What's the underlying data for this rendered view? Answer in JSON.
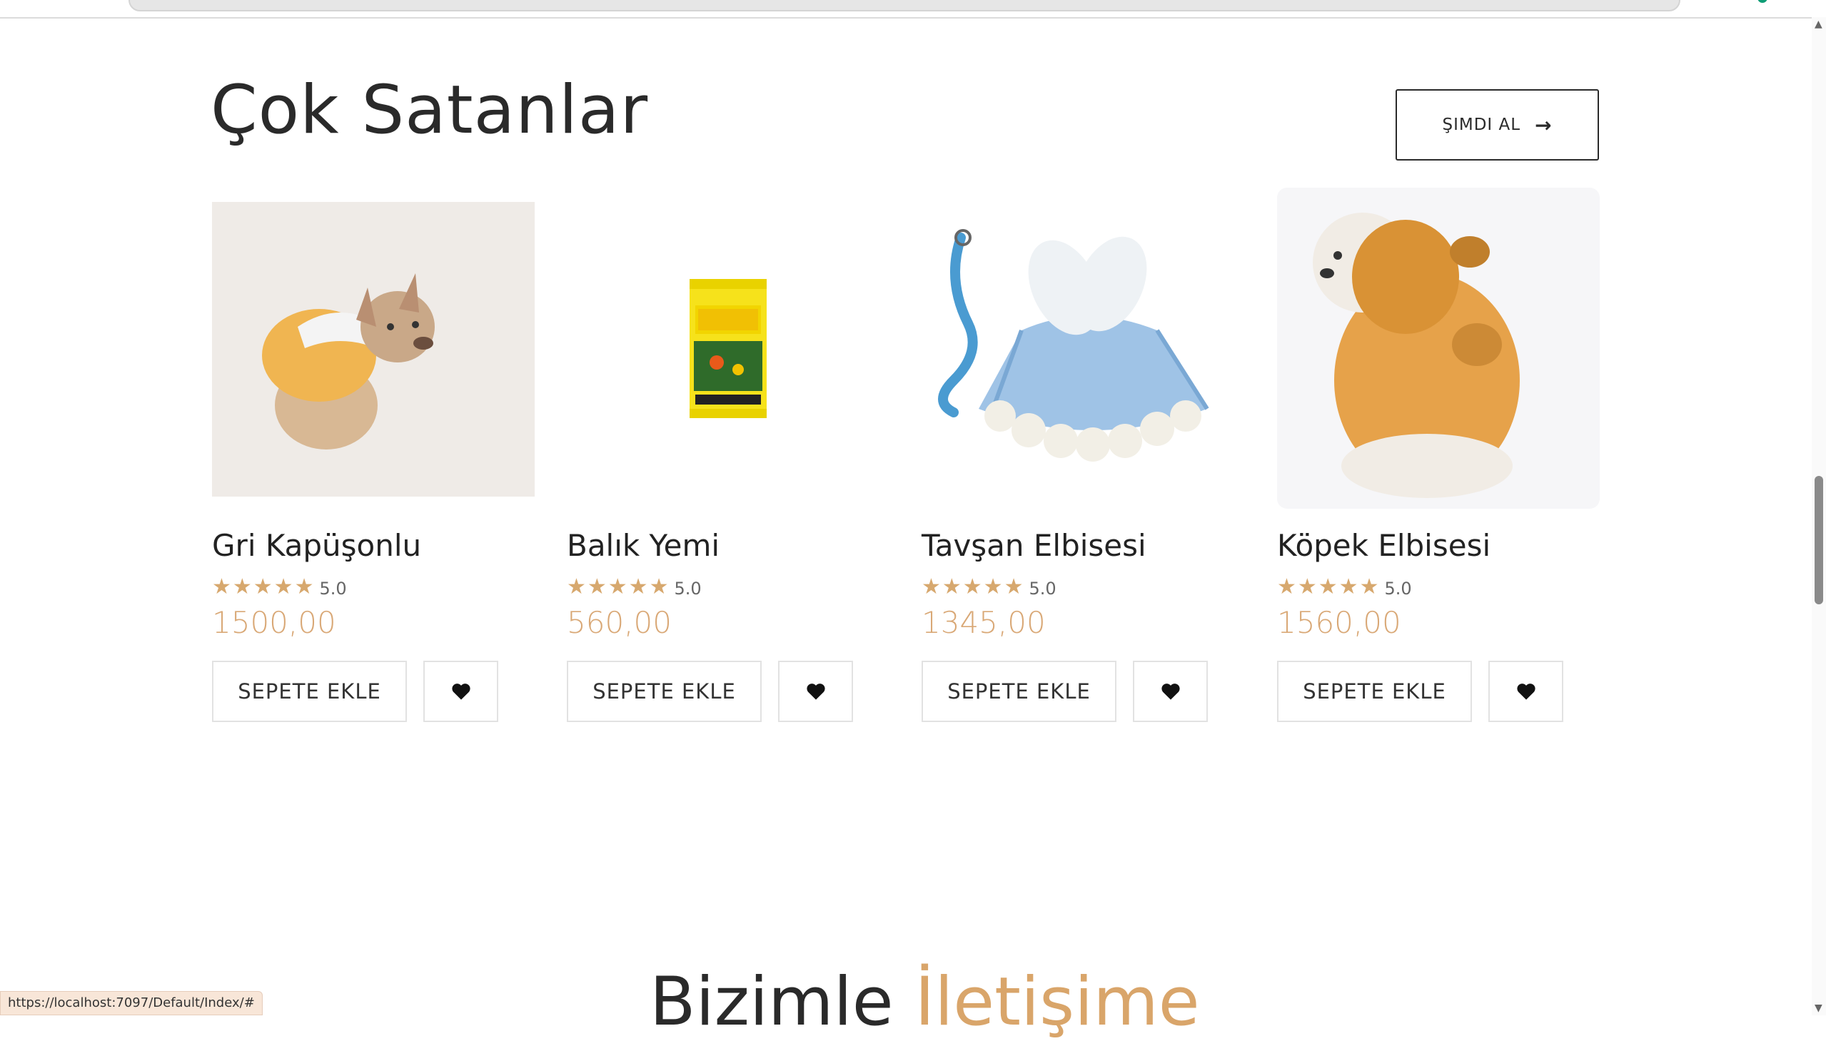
{
  "section": {
    "title": "Çok Satanlar",
    "shop_button": "ŞIMDI AL"
  },
  "products": [
    {
      "name": "Gri Kapüşonlu",
      "stars": "★★★★★",
      "rating": "5.0",
      "price": "1500,00",
      "cart_label": "SEPETE EKLE"
    },
    {
      "name": "Balık Yemi",
      "stars": "★★★★★",
      "rating": "5.0",
      "price": "560,00",
      "cart_label": "SEPETE EKLE"
    },
    {
      "name": "Tavşan Elbisesi",
      "stars": "★★★★★",
      "rating": "5.0",
      "price": "1345,00",
      "cart_label": "SEPETE EKLE"
    },
    {
      "name": "Köpek Elbisesi",
      "stars": "★★★★★",
      "rating": "5.0",
      "price": "1560,00",
      "cart_label": "SEPETE EKLE"
    }
  ],
  "product_images": [
    "french-bulldog-in-yellow-hoodie",
    "tropical-fish-food-can",
    "blue-bunny-pet-dress-with-leash",
    "poodle-in-orange-teddy-suit"
  ],
  "contact": {
    "title_part1": "Bizimle",
    "title_part2": "İletişime"
  },
  "status_bar": {
    "url": "https://localhost:7097/Default/Index/#"
  },
  "colors": {
    "accent": "#d9a876",
    "star": "#d7a86e",
    "text": "#2a2a2a"
  }
}
